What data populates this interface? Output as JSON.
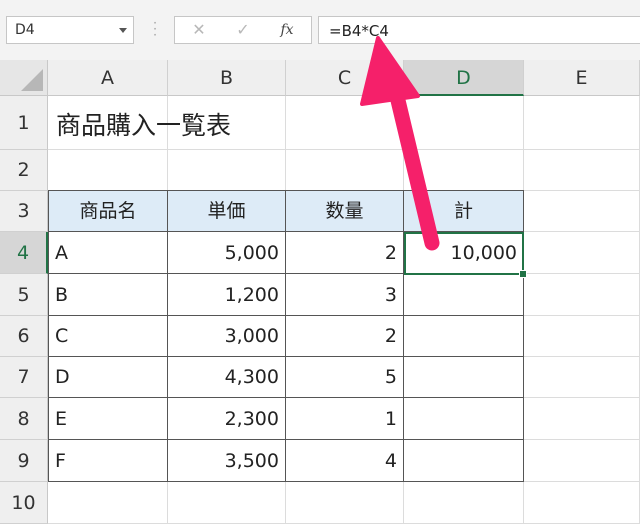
{
  "formula_bar": {
    "name_box": "D4",
    "fx_label": "fx",
    "cancel_symbol": "✕",
    "enter_symbol": "✓",
    "formula": "=B4*C4"
  },
  "columns": [
    "A",
    "B",
    "C",
    "D",
    "E"
  ],
  "rows": [
    "1",
    "2",
    "3",
    "4",
    "5",
    "6",
    "7",
    "8",
    "9",
    "10"
  ],
  "sheet": {
    "title": "商品購入一覧表",
    "headers": [
      "商品名",
      "単価",
      "数量",
      "計"
    ],
    "data": [
      {
        "name": "A",
        "price": "5,000",
        "qty": "2",
        "total": "10,000"
      },
      {
        "name": "B",
        "price": "1,200",
        "qty": "3",
        "total": ""
      },
      {
        "name": "C",
        "price": "3,000",
        "qty": "2",
        "total": ""
      },
      {
        "name": "D",
        "price": "4,300",
        "qty": "5",
        "total": ""
      },
      {
        "name": "E",
        "price": "2,300",
        "qty": "1",
        "total": ""
      },
      {
        "name": "F",
        "price": "3,500",
        "qty": "4",
        "total": ""
      }
    ]
  },
  "selection": {
    "active_cell": "D4"
  },
  "colors": {
    "accent": "#217346",
    "header_fill": "#ddebf7",
    "arrow": "#f5206a"
  }
}
